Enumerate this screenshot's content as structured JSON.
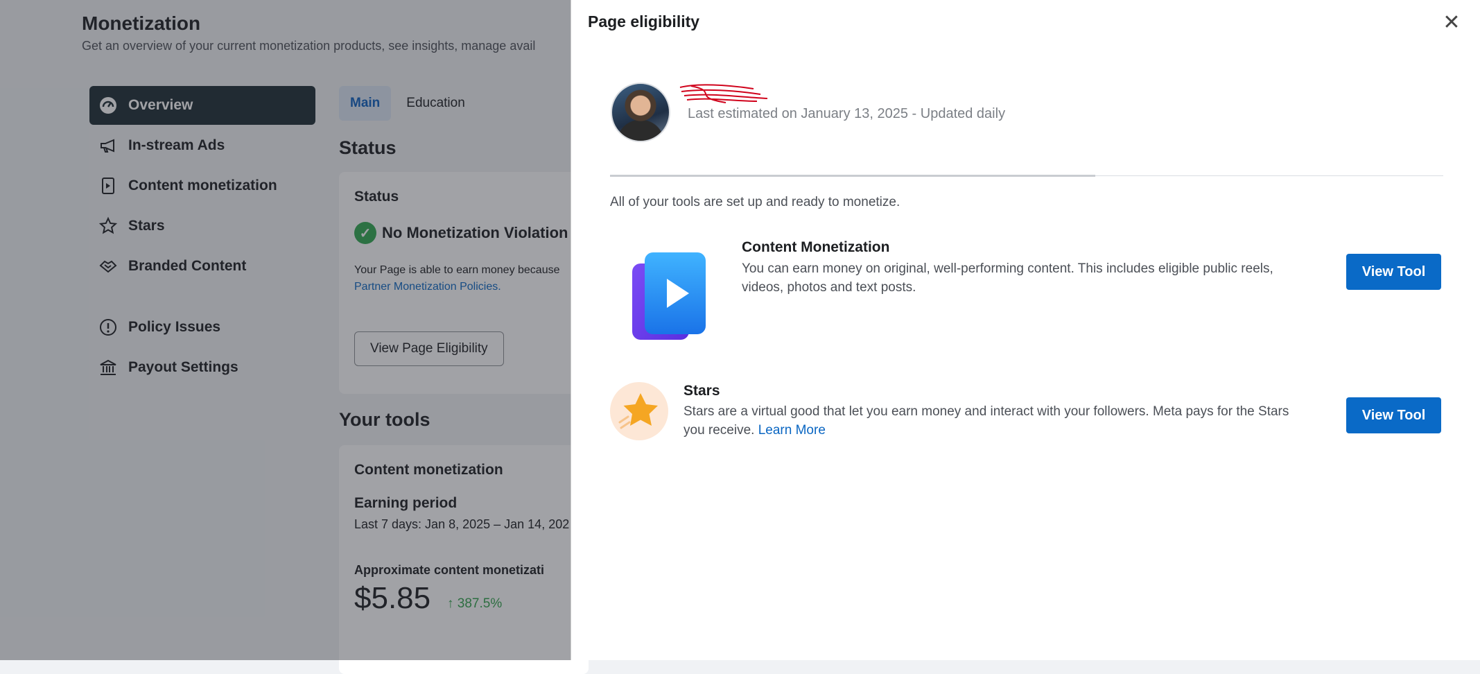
{
  "background": {
    "title": "Monetization",
    "subtitle": "Get an overview of your current monetization products, see insights, manage avail",
    "sidebar": {
      "items": [
        {
          "label": "Overview",
          "icon": "dashboard-icon",
          "active": true
        },
        {
          "label": "In-stream Ads",
          "icon": "megaphone-icon"
        },
        {
          "label": "Content monetization",
          "icon": "play-document-icon"
        },
        {
          "label": "Stars",
          "icon": "star-outline-icon"
        },
        {
          "label": "Branded Content",
          "icon": "handshake-icon"
        },
        {
          "label": "Policy Issues",
          "icon": "alert-circle-icon"
        },
        {
          "label": "Payout Settings",
          "icon": "bank-icon"
        }
      ]
    },
    "tabs": [
      {
        "label": "Main",
        "active": true
      },
      {
        "label": "Education"
      }
    ],
    "status_heading": "Status",
    "status_card": {
      "title": "Status",
      "violation_text": "No Monetization Violation",
      "body_line1": "Your Page is able to earn money because",
      "body_link": "Partner Monetization Policies.",
      "button_label": "View Page Eligibility"
    },
    "tools_heading": "Your tools",
    "tools_card": {
      "title": "Content monetization",
      "earning_heading": "Earning period",
      "earning_dates": "Last 7 days: Jan 8, 2025 – Jan 14, 202",
      "approx_label": "Approximate content monetizati",
      "amount": "$5.85",
      "growth": "↑ 387.5%"
    }
  },
  "dialog": {
    "title": "Page eligibility",
    "close_icon": "close-icon",
    "last_estimated": "Last estimated on January 13, 2025 - Updated daily",
    "ready_text": "All of your tools are set up and ready to monetize.",
    "tools": [
      {
        "title": "Content Monetization",
        "description": "You can earn money on original, well-performing content. This includes eligible public reels, videos, photos and text posts.",
        "button_label": "View Tool",
        "icon": "play-card-icon"
      },
      {
        "title": "Stars",
        "description": "Stars are a virtual good that let you earn money and interact with your followers. Meta pays for the Stars you receive.",
        "link_label": "Learn More",
        "button_label": "View Tool",
        "icon": "star-icon"
      }
    ]
  },
  "colors": {
    "primary_button": "#0a6ac7",
    "active_sidebar": "#1c2b33",
    "success": "#31a24c",
    "redaction": "#d0021b"
  }
}
